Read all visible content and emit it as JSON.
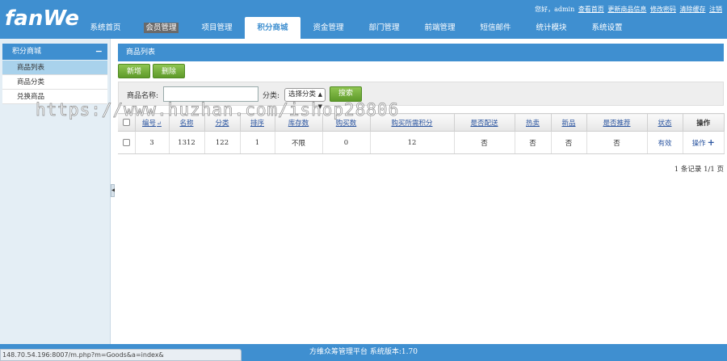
{
  "header": {
    "logo": "fanWe",
    "greeting": "您好，admin",
    "user_links": [
      "查看首页",
      "更新商品信息",
      "修改密码",
      "清除缓存",
      "注销"
    ],
    "nav": [
      {
        "label": "系统首页"
      },
      {
        "label": "会员管理"
      },
      {
        "label": "项目管理"
      },
      {
        "label": "积分商城"
      },
      {
        "label": "资金管理"
      },
      {
        "label": "部门管理"
      },
      {
        "label": "前端管理"
      },
      {
        "label": "短信邮件"
      },
      {
        "label": "统计模块"
      },
      {
        "label": "系统设置"
      }
    ],
    "active_nav": "积分商城"
  },
  "sidebar": {
    "title": "积分商城",
    "collapse_symbol": "−",
    "items": [
      {
        "label": "商品列表",
        "active": true
      },
      {
        "label": "商品分类",
        "active": false
      },
      {
        "label": "兑换商品",
        "active": false
      }
    ],
    "splitter_arrow": "◀"
  },
  "content": {
    "panel_title": "商品列表",
    "buttons": {
      "add": "新增",
      "delete": "删除"
    },
    "search": {
      "name_label": "商品名称:",
      "name_value": "",
      "category_label": "分类:",
      "category_selected": "选择分类",
      "search_button": "搜索"
    },
    "table": {
      "columns": [
        "",
        "编号",
        "名称",
        "分类",
        "排序",
        "库存数",
        "购买数",
        "购买所需积分",
        "是否配送",
        "热卖",
        "新品",
        "是否推荐",
        "状态",
        "操作"
      ],
      "rows": [
        {
          "id": "3",
          "name": "1312",
          "category": "122",
          "sort": "1",
          "stock": "不限",
          "bought": "0",
          "points": "12",
          "delivery": "否",
          "hot": "否",
          "new": "否",
          "recommend": "否",
          "status": "有效",
          "action": "操作",
          "action_plus": "+"
        }
      ]
    },
    "pager": "1 条记录 1/1 页"
  },
  "watermark": "https://www.huzhan.com/ishop28806",
  "footer": {
    "text": "方维众筹管理平台 系统版本:1.70",
    "status_url": "148.70.54.196:8007/m.php?m=Goods&a=index&"
  },
  "colors": {
    "primary": "#3f8fd0",
    "button_green": "#6aa935",
    "link": "#2b55a0",
    "sidebar_active": "#a9d2ec"
  }
}
